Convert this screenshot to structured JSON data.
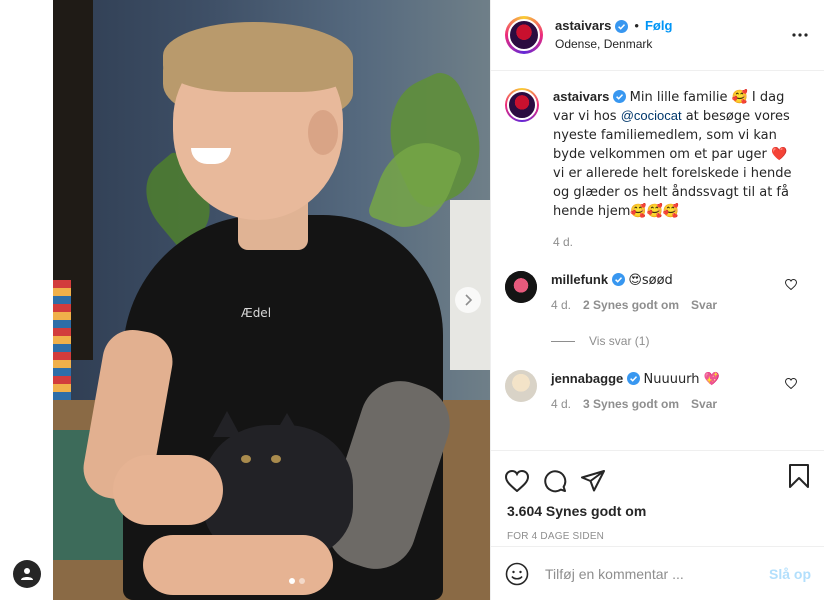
{
  "post": {
    "author": "astaivars",
    "follow_label": "Følg",
    "separator": "•",
    "location": "Odense, Denmark",
    "media": {
      "shirt_logo": "Ædel",
      "slide_count": 2,
      "active_slide": 1
    }
  },
  "caption": {
    "username": "astaivars",
    "text_part1": "Min lille familie 🥰 I dag var vi hos ",
    "mention": "@cociocat",
    "text_part2": " at besøge vores nyeste familiemedlem, som vi kan byde velkommen om et par uger ❤️ vi er allerede helt forelskede i hende og glæder os helt åndssvagt til at få hende hjem🥰🥰🥰",
    "age": "4 d."
  },
  "comments": [
    {
      "username": "millefunk",
      "text": "😍søød",
      "age": "4 d.",
      "likes": "2 Synes godt om",
      "reply": "Svar"
    },
    {
      "username": "jennabagge",
      "text": "Nuuuurh 💖",
      "age": "4 d.",
      "likes": "3 Synes godt om",
      "reply": "Svar"
    }
  ],
  "view_replies": "Vis svar (1)",
  "footer": {
    "likes": "3.604 Synes godt om",
    "time_ago": "FOR 4 DAGE SIDEN",
    "comment_placeholder": "Tilføj en kommentar ...",
    "post_label": "Slå op"
  },
  "colors": {
    "accent": "#0095f6",
    "post_disabled": "#b2dffc",
    "muted": "#8e8e8e"
  }
}
